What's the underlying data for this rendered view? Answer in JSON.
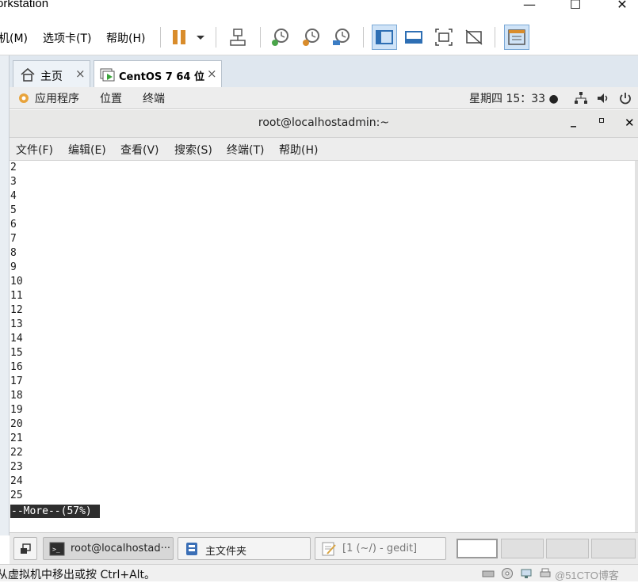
{
  "vmware": {
    "window_title": "orkstation",
    "menu": [
      "机(M)",
      "选项卡(T)",
      "帮助(H)"
    ],
    "tabs": [
      {
        "label": "主页",
        "close": "×"
      },
      {
        "label": "CentOS 7 64 位",
        "close": "×"
      }
    ],
    "status_hint": "从虚拟机中移出或按 Ctrl+Alt。",
    "watermark": "@51CTO博客"
  },
  "gnome": {
    "top_bar": {
      "applications": "应用程序",
      "places": "位置",
      "terminal": "终端",
      "clock": "星期四 15：33 ●"
    },
    "bottom_panel": {
      "tasks": [
        {
          "label": "root@localhostad···",
          "icon": "terminal-icon"
        },
        {
          "label": "主文件夹",
          "icon": "file-manager-icon"
        },
        {
          "label": "[1 (~/) - gedit]",
          "icon": "gedit-icon"
        }
      ]
    }
  },
  "terminal": {
    "title": "root@localhostadmin:~",
    "menu": [
      "文件(F)",
      "编辑(E)",
      "查看(V)",
      "搜索(S)",
      "终端(T)",
      "帮助(H)"
    ],
    "lines": [
      "2",
      "3",
      "4",
      "5",
      "6",
      "7",
      "8",
      "9",
      "10",
      "11",
      "12",
      "13",
      "14",
      "15",
      "16",
      "17",
      "18",
      "19",
      "20",
      "21",
      "22",
      "23",
      "24",
      "25"
    ],
    "more_prompt": "--More--(57%)"
  },
  "colors": {
    "toolbar_active": "#cfe3f7",
    "gnome_bar": "#ededed",
    "more_bg": "#2e2e2e",
    "pause_orange": "#d98c2b"
  }
}
